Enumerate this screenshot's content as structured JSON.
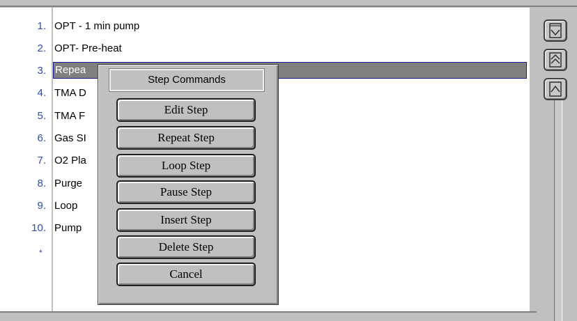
{
  "steps": [
    {
      "num": "1.",
      "label": "OPT - 1 min pump"
    },
    {
      "num": "2.",
      "label": "OPT- Pre-heat"
    },
    {
      "num": "3.",
      "label": "Repea"
    },
    {
      "num": "4.",
      "label": "TMA D"
    },
    {
      "num": "5.",
      "label": "TMA F"
    },
    {
      "num": "6.",
      "label": "Gas SI"
    },
    {
      "num": "7.",
      "label": "O2 Pla"
    },
    {
      "num": "8.",
      "label": "Purge"
    },
    {
      "num": "9.",
      "label": "Loop"
    },
    {
      "num": "10.",
      "label": "Pump"
    }
  ],
  "new_row_marker": "*",
  "popup": {
    "title": "Step Commands",
    "commands": [
      "Edit Step",
      "Repeat Step",
      "Loop Step",
      "Pause Step",
      "Insert Step",
      "Delete Step",
      "Cancel"
    ]
  },
  "scroll_buttons": [
    {
      "icon": "scroll-to-bottom-icon"
    },
    {
      "icon": "page-up-icon"
    },
    {
      "icon": "line-up-icon"
    }
  ],
  "colors": {
    "number_text": "#2a4bb0",
    "selection": "#808080",
    "selection_border": "#1b1b8f"
  }
}
